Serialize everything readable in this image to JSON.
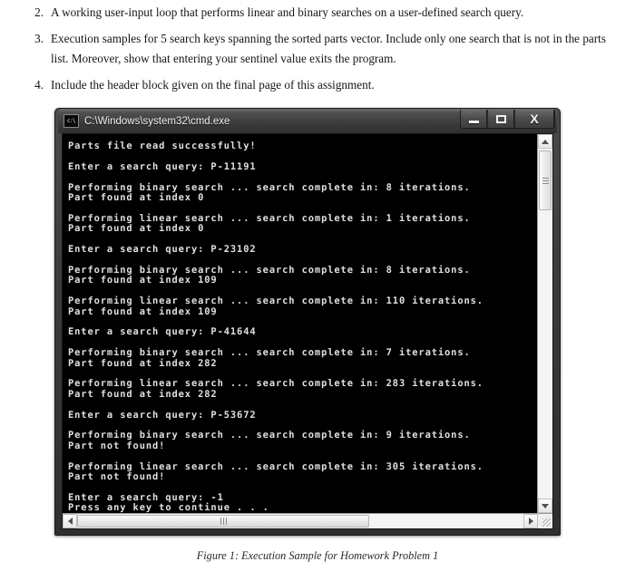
{
  "document": {
    "items": [
      {
        "number": "2.",
        "text": "A working user-input loop that performs linear and binary searches on a user-defined search query."
      },
      {
        "number": "3.",
        "text": "Execution samples for 5 search keys spanning the sorted parts vector. Include only one search that is not in the parts list. Moreover, show that entering your sentinel value exits the program."
      },
      {
        "number": "4.",
        "text": "Include the header block given on the final page of this assignment."
      }
    ]
  },
  "window": {
    "title": "C:\\Windows\\system32\\cmd.exe",
    "icon_name": "cmd-exe-icon",
    "icon_text": "c:\\",
    "buttons": {
      "minimize": "minimize-button",
      "maximize": "maximize-button",
      "close_label": "X"
    },
    "colors": {
      "console_background": "#000000",
      "console_text": "#e0e0e0",
      "titlebar": "#3a3a3a",
      "frame": "#2f2f2f",
      "scrollbar_face": "#f0f0f0"
    }
  },
  "console": {
    "lines": [
      "Parts file read successfully!",
      "",
      "Enter a search query: P-11191",
      "",
      "Performing binary search ... search complete in: 8 iterations.",
      "Part found at index 0",
      "",
      "Performing linear search ... search complete in: 1 iterations.",
      "Part found at index 0",
      "",
      "Enter a search query: P-23102",
      "",
      "Performing binary search ... search complete in: 8 iterations.",
      "Part found at index 109",
      "",
      "Performing linear search ... search complete in: 110 iterations.",
      "Part found at index 109",
      "",
      "Enter a search query: P-41644",
      "",
      "Performing binary search ... search complete in: 7 iterations.",
      "Part found at index 282",
      "",
      "Performing linear search ... search complete in: 283 iterations.",
      "Part found at index 282",
      "",
      "Enter a search query: P-53672",
      "",
      "Performing binary search ... search complete in: 9 iterations.",
      "Part not found!",
      "",
      "Performing linear search ... search complete in: 305 iterations.",
      "Part not found!",
      "",
      "Enter a search query: -1",
      "Press any key to continue . . ."
    ]
  },
  "scrollbars": {
    "vertical": {
      "up_arrow": "scroll-up-arrow",
      "down_arrow": "scroll-down-arrow",
      "thumb": "vertical-scroll-thumb"
    },
    "horizontal": {
      "left_arrow": "scroll-left-arrow",
      "right_arrow": "scroll-right-arrow",
      "thumb": "horizontal-scroll-thumb"
    }
  },
  "caption": {
    "text": "Figure 1: Execution Sample for Homework Problem 1"
  }
}
